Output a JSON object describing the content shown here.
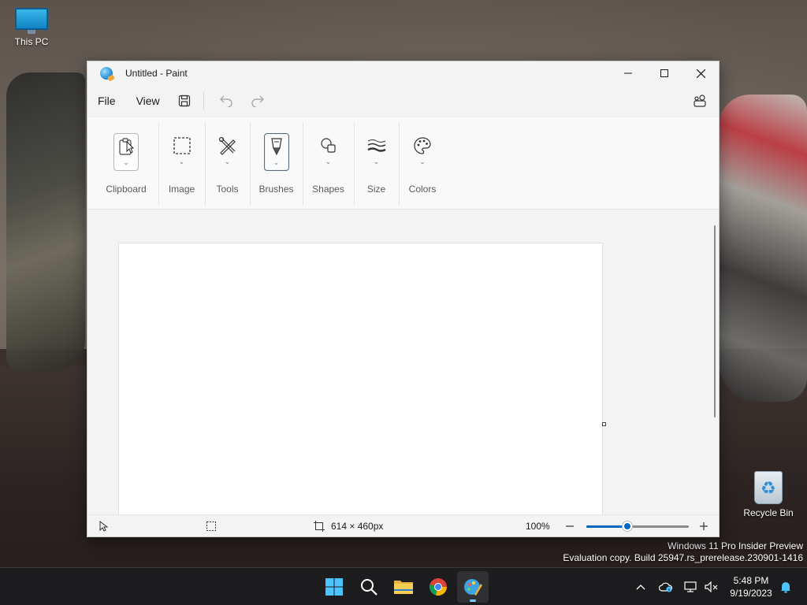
{
  "desktop": {
    "icons": [
      {
        "label": "This PC"
      },
      {
        "label": "Recycle Bin"
      }
    ],
    "watermark": {
      "line1": "Windows 11 Pro Insider Preview",
      "line2": "Evaluation copy. Build 25947.rs_prerelease.230901-1416"
    }
  },
  "window": {
    "title": "Untitled - Paint",
    "controls": {
      "minimize": "—",
      "maximize": "☐",
      "close": "✕"
    }
  },
  "menubar": {
    "file": "File",
    "view": "View"
  },
  "ribbon": {
    "groups": [
      {
        "label": "Clipboard"
      },
      {
        "label": "Image"
      },
      {
        "label": "Tools"
      },
      {
        "label": "Brushes"
      },
      {
        "label": "Shapes"
      },
      {
        "label": "Size"
      },
      {
        "label": "Colors"
      }
    ]
  },
  "statusbar": {
    "canvas_size": "614 × 460px",
    "zoom": "100%",
    "zoom_level": 0.4
  },
  "taskbar": {
    "clock_time": "5:48 PM",
    "clock_date": "9/19/2023"
  },
  "colors": {
    "accent": "#0067c0",
    "window_bg": "#f3f3f3",
    "taskbar_bg": "#1c1c1e"
  }
}
